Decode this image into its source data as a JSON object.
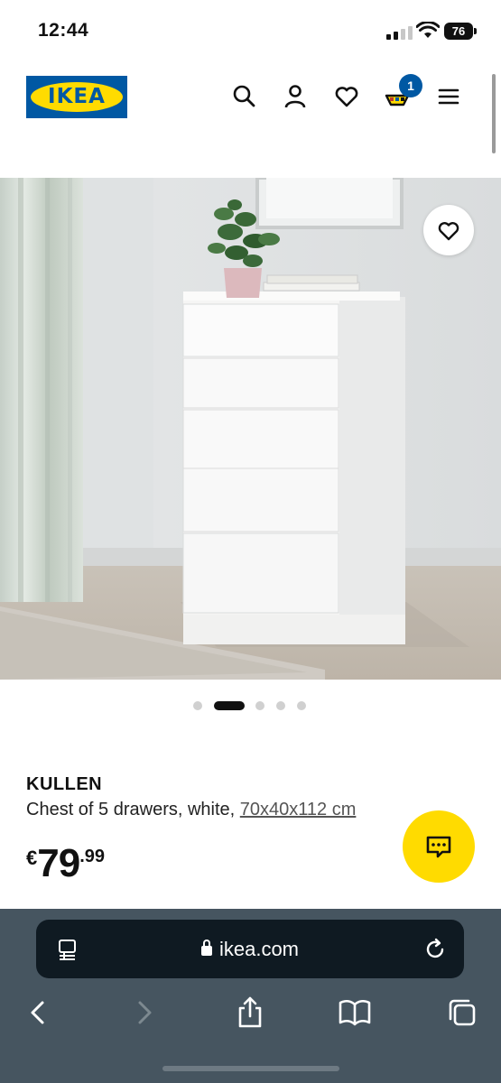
{
  "status_bar": {
    "time": "12:44",
    "battery": "76"
  },
  "header": {
    "logo_text": "IKEA",
    "cart_count": "1",
    "icons": [
      "search-icon",
      "account-icon",
      "heart-icon",
      "cart-icon",
      "menu-icon"
    ]
  },
  "gallery": {
    "image_count": 5,
    "active_index": 1
  },
  "product": {
    "name": "KULLEN",
    "description": "Chest of 5 drawers, white, ",
    "dimensions": "70x40x112 cm",
    "price_currency": "€",
    "price_int": "79",
    "price_dec": ".99"
  },
  "browser": {
    "url": "ikea.com"
  },
  "colors": {
    "ikea_blue": "#0058a3",
    "ikea_yellow": "#ffdb00",
    "toolbar": "#465560",
    "urlbar": "#0f1a22"
  }
}
